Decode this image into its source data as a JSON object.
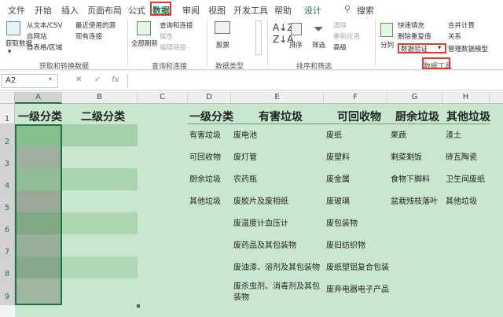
{
  "tabs": [
    "文件",
    "开始",
    "插入",
    "页面布局",
    "公式",
    "数据",
    "审阅",
    "视图",
    "开发工具",
    "帮助",
    "设计"
  ],
  "search_label": "搜索",
  "ribbon": {
    "get_data": "获取数据",
    "from_text_csv": "从文本/CSV",
    "from_web": "自网站",
    "from_table": "自表格/区域",
    "recent_sources": "最近使用的源",
    "existing_conn": "现有连接",
    "group_get": "获取和转换数据",
    "refresh_all": "全部刷新",
    "queries_conn": "查询和连接",
    "properties": "属性",
    "edit_links": "编辑链接",
    "group_queries": "查询和连接",
    "stocks": "股票",
    "group_datatypes": "数据类型",
    "sort": "排序",
    "filter": "筛选",
    "clear": "清除",
    "reapply": "重新应用",
    "advanced": "高级",
    "group_sortfilter": "排序和筛选",
    "split": "分列",
    "flash_fill": "快速填充",
    "remove_dup": "删除重复值",
    "data_validation": "数据验证",
    "consolidate": "合并计算",
    "relationships": "关系",
    "data_model": "管理数据模型",
    "group_datatools": "数据工具"
  },
  "formula_bar": {
    "name_box": "A2",
    "cancel": "✕",
    "enter": "✓",
    "fx": "fx",
    "content": ""
  },
  "columns": [
    "A",
    "B",
    "C",
    "D",
    "E",
    "F",
    "G",
    "H"
  ],
  "rows": [
    "1",
    "2",
    "3",
    "4",
    "5",
    "6",
    "7",
    "8",
    "9"
  ],
  "sheet": {
    "a1": "一级分类",
    "b1": "二级分类",
    "headers": [
      "一级分类",
      "有害垃圾",
      "可回收物",
      "厨余垃圾",
      "其他垃圾"
    ],
    "col_d": [
      "有害垃圾",
      "可回收物",
      "厨余垃圾",
      "其他垃圾"
    ],
    "col_e": [
      "废电池",
      "废灯管",
      "农药瓶",
      "废胶片及废相纸",
      "废温度计血压计",
      "废药品及其包装物",
      "废油漆、溶剂及其包装物",
      "废杀虫剂、消毒剂及其包",
      "装物"
    ],
    "col_f": [
      "废纸",
      "废塑料",
      "废金属",
      "废玻璃",
      "废包装物",
      "废旧纺织物",
      "废纸塑铝复合包装",
      "废弃电器电子产品"
    ],
    "col_g": [
      "果蔬",
      "剩菜剩饭",
      "食物下脚料",
      "盆栽残枝落叶"
    ],
    "col_h": [
      "渣土",
      "砖瓦陶瓷",
      "卫生间废纸",
      "其他垃圾"
    ]
  }
}
